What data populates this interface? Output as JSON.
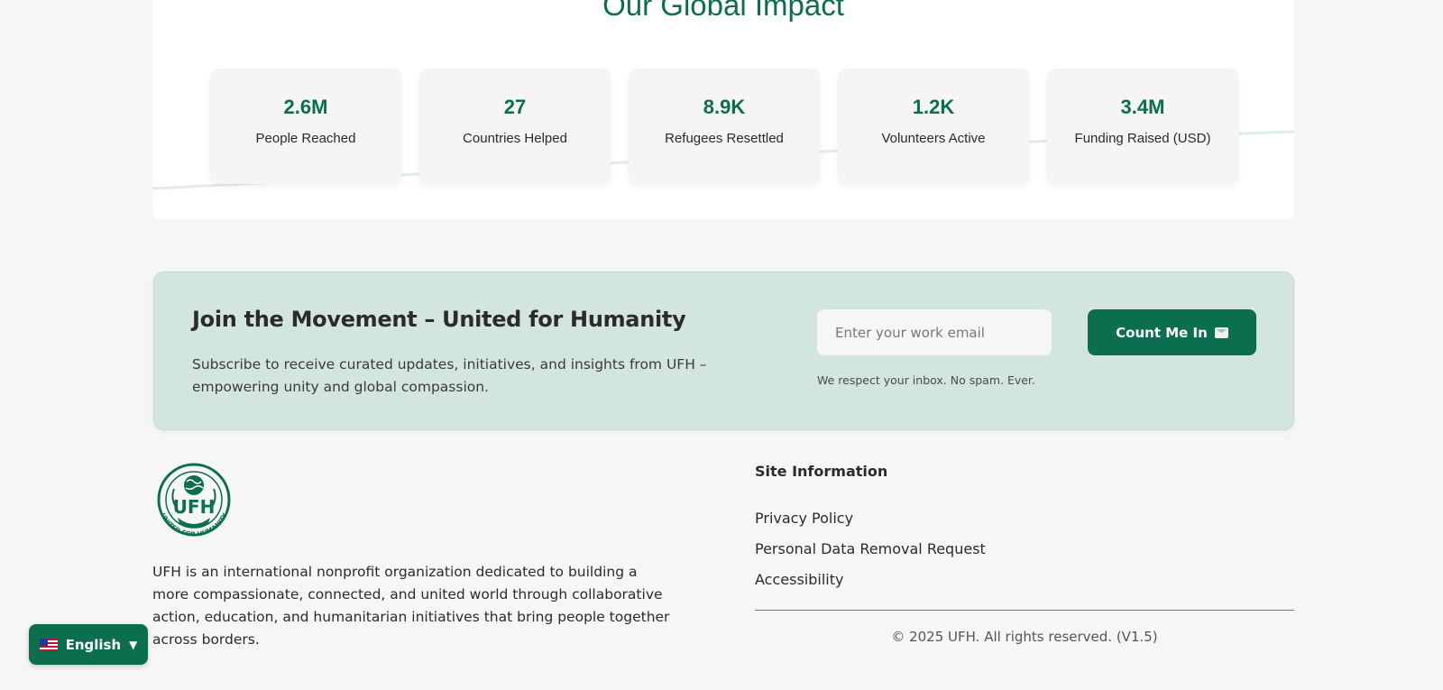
{
  "impact": {
    "title": "Our Global Impact",
    "stats": [
      {
        "value": "2.6M",
        "label": "People Reached"
      },
      {
        "value": "27",
        "label": "Countries Helped"
      },
      {
        "value": "8.9K",
        "label": "Refugees Resettled"
      },
      {
        "value": "1.2K",
        "label": "Volunteers Active"
      },
      {
        "value": "3.4M",
        "label": "Funding Raised (USD)"
      }
    ]
  },
  "newsletter": {
    "title": "Join the Movement – United for Humanity",
    "description": "Subscribe to receive curated updates, initiatives, and insights from UFH – empowering unity and global compassion.",
    "email_placeholder": "Enter your work email",
    "button_label": "Count Me In",
    "button_icon": "envelope-icon",
    "note": "We respect your inbox. No spam. Ever."
  },
  "footer": {
    "logo_text": "UFH",
    "logo_ring_text": "UNITED FOR HUMANITY",
    "about": "UFH is an international nonprofit organization dedicated to building a more compassionate, connected, and united world through collaborative action, education, and humanitarian initiatives that bring people together across borders.",
    "site_info_heading": "Site Information",
    "links": [
      {
        "label": "Privacy Policy"
      },
      {
        "label": "Personal Data Removal Request"
      },
      {
        "label": "Accessibility"
      }
    ],
    "copyright": "© 2025 UFH. All rights reserved. (V1.5)"
  },
  "language": {
    "label": "English",
    "flag_icon": "us-flag-icon",
    "caret": "▼"
  },
  "colors": {
    "brand": "#0b6e4f",
    "newsletter_bg": "#d3e5df",
    "page_bg": "#f6f6f6"
  }
}
